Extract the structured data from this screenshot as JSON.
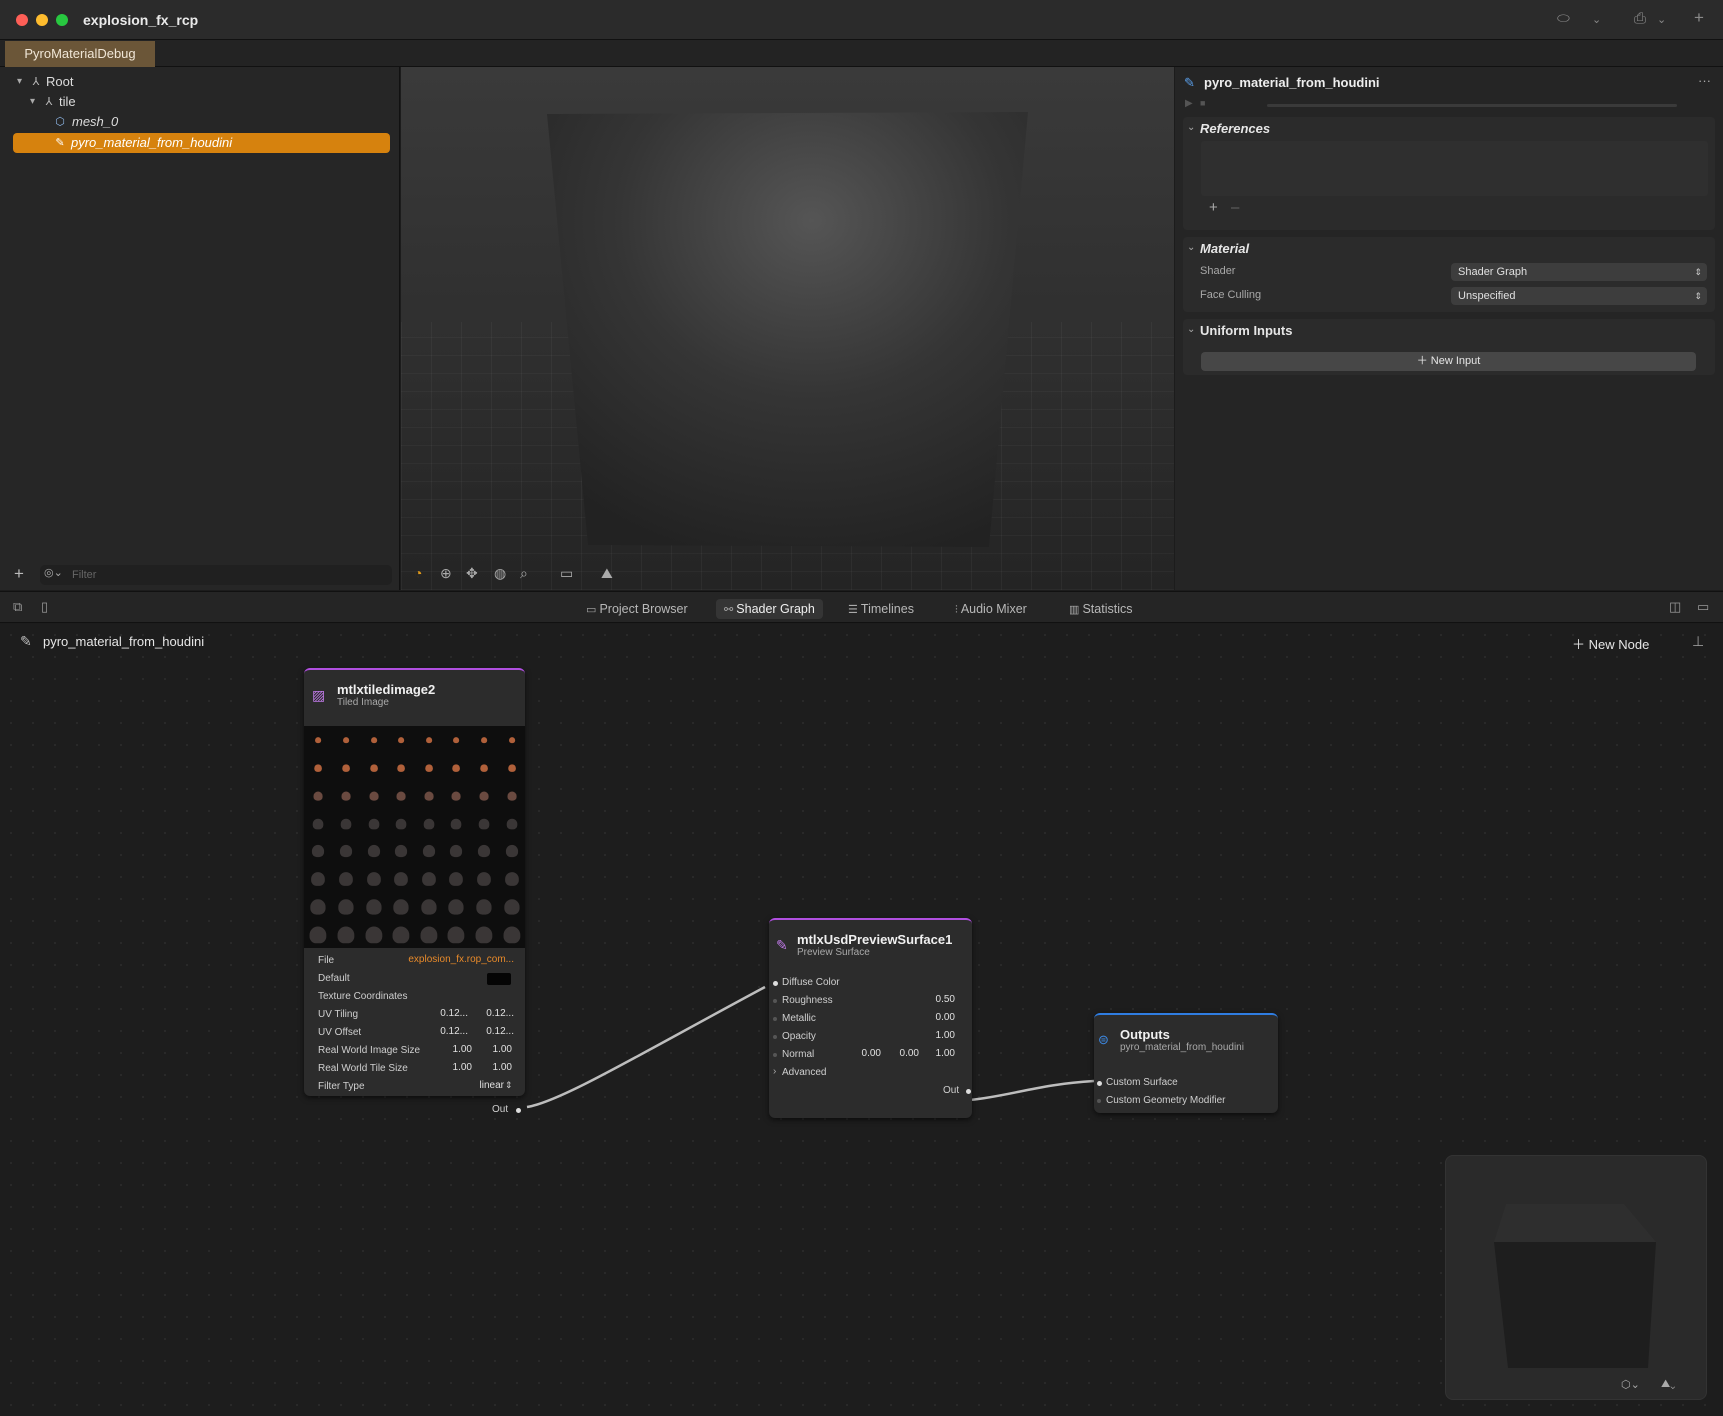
{
  "window": {
    "title": "explosion_fx_rcp",
    "scene_tab": "PyroMaterialDebug"
  },
  "hierarchy": {
    "items": [
      {
        "label": "Root"
      },
      {
        "label": "tile"
      },
      {
        "label": "mesh_0"
      },
      {
        "label": "pyro_material_from_houdini"
      }
    ],
    "filter_placeholder": "Filter"
  },
  "inspector": {
    "title": "pyro_material_from_houdini",
    "references_title": "References",
    "material_title": "Material",
    "shader_label": "Shader",
    "shader_value": "Shader Graph",
    "face_culling_label": "Face Culling",
    "face_culling_value": "Unspecified",
    "uniform_inputs_title": "Uniform Inputs",
    "new_input_label": "New Input"
  },
  "bottom_tabs": [
    "Project Browser",
    "Shader Graph",
    "Timelines",
    "Audio Mixer",
    "Statistics"
  ],
  "active_tab": "Shader Graph",
  "graph": {
    "breadcrumb": "pyro_material_from_houdini",
    "new_node_label": "New Node",
    "tiled_image": {
      "title": "mtlxtiledimage2",
      "subtitle": "Tiled Image",
      "file_label": "File",
      "file_value": "explosion_fx.rop_com...",
      "default_label": "Default",
      "texcoord_label": "Texture Coordinates",
      "uv_tiling_label": "UV Tiling",
      "uv_tiling": [
        "0.12...",
        "0.12..."
      ],
      "uv_offset_label": "UV Offset",
      "uv_offset": [
        "0.12...",
        "0.12..."
      ],
      "rw_image_label": "Real World Image Size",
      "rw_image": [
        "1.00",
        "1.00"
      ],
      "rw_tile_label": "Real World Tile Size",
      "rw_tile": [
        "1.00",
        "1.00"
      ],
      "filter_label": "Filter Type",
      "filter_value": "linear",
      "out_label": "Out"
    },
    "preview_surface": {
      "title": "mtlxUsdPreviewSurface1",
      "subtitle": "Preview Surface",
      "diffuse_label": "Diffuse Color",
      "roughness_label": "Roughness",
      "roughness": "0.50",
      "metallic_label": "Metallic",
      "metallic": "0.00",
      "opacity_label": "Opacity",
      "opacity": "1.00",
      "normal_label": "Normal",
      "normal": [
        "0.00",
        "0.00",
        "1.00"
      ],
      "advanced_label": "Advanced",
      "out_label": "Out"
    },
    "outputs": {
      "title": "Outputs",
      "subtitle": "pyro_material_from_houdini",
      "custom_surface_label": "Custom Surface",
      "custom_geometry_label": "Custom Geometry Modifier"
    }
  },
  "colors": {
    "selection": "#d6820e",
    "node_accent_purple": "#b04fe0",
    "outputs_accent": "#2f7de1"
  }
}
